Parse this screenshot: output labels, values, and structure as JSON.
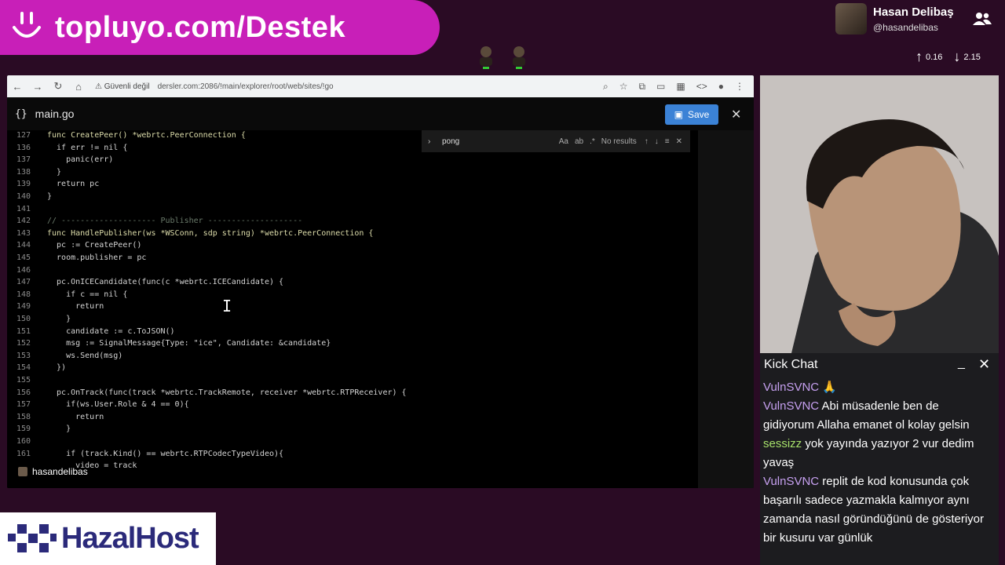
{
  "banner": {
    "text": "topluyo.com/Destek"
  },
  "streamer": {
    "name": "Hasan Delibaş",
    "handle": "@hasandelibas",
    "up": "0.16",
    "down": "2.15"
  },
  "browser": {
    "security": "Güvenli değil",
    "url": "dersler.com:2086/!main/explorer/root/web/sites/!go"
  },
  "editor": {
    "filename": "main.go",
    "save_label": "Save",
    "find_query": "pong",
    "find_result": "No results",
    "lines": [
      {
        "n": "127",
        "t": "func CreatePeer() *webrtc.PeerConnection {"
      },
      {
        "n": "136",
        "t": "  if err != nil {"
      },
      {
        "n": "137",
        "t": "    panic(err)"
      },
      {
        "n": "138",
        "t": "  }"
      },
      {
        "n": "139",
        "t": "  return pc"
      },
      {
        "n": "140",
        "t": "}"
      },
      {
        "n": "141",
        "t": ""
      },
      {
        "n": "142",
        "t": "// -------------------- Publisher --------------------"
      },
      {
        "n": "143",
        "t": "func HandlePublisher(ws *WSConn, sdp string) *webrtc.PeerConnection {"
      },
      {
        "n": "144",
        "t": "  pc := CreatePeer()"
      },
      {
        "n": "145",
        "t": "  room.publisher = pc"
      },
      {
        "n": "146",
        "t": ""
      },
      {
        "n": "147",
        "t": "  pc.OnICECandidate(func(c *webrtc.ICECandidate) {"
      },
      {
        "n": "148",
        "t": "    if c == nil {"
      },
      {
        "n": "149",
        "t": "      return"
      },
      {
        "n": "150",
        "t": "    }"
      },
      {
        "n": "151",
        "t": "    candidate := c.ToJSON()"
      },
      {
        "n": "152",
        "t": "    msg := SignalMessage{Type: \"ice\", Candidate: &candidate}"
      },
      {
        "n": "153",
        "t": "    ws.Send(msg)"
      },
      {
        "n": "154",
        "t": "  })"
      },
      {
        "n": "155",
        "t": ""
      },
      {
        "n": "156",
        "t": "  pc.OnTrack(func(track *webrtc.TrackRemote, receiver *webrtc.RTPReceiver) {"
      },
      {
        "n": "157",
        "t": "    if(ws.User.Role & 4 == 0){"
      },
      {
        "n": "158",
        "t": "      return"
      },
      {
        "n": "159",
        "t": "    }"
      },
      {
        "n": "160",
        "t": ""
      },
      {
        "n": "161",
        "t": "    if (track.Kind() == webrtc.RTPCodecTypeVideo){"
      },
      {
        "n": "",
        "t": "      video = track"
      }
    ],
    "user_tag": "hasandelibas"
  },
  "chat": {
    "title": "Kick Chat",
    "messages": [
      {
        "user": "VulnSVNC",
        "text": "🙏",
        "cls": "u1"
      },
      {
        "user": "VulnSVNC",
        "text": "Abi müsadenle ben de gidiyorum Allaha emanet ol kolay gelsin",
        "cls": "u1"
      },
      {
        "user": "sessizz",
        "text": "yok yayında yazıyor 2 vur dedim yavaş",
        "cls": "u2"
      },
      {
        "user": "VulnSVNC",
        "text": "replit de kod konusunda çok başarılı sadece yazmakla kalmıyor aynı zamanda nasıl göründüğünü de gösteriyor bir kusuru var günlük",
        "cls": "u1"
      }
    ]
  },
  "sponsor": {
    "name": "HazalHost"
  }
}
